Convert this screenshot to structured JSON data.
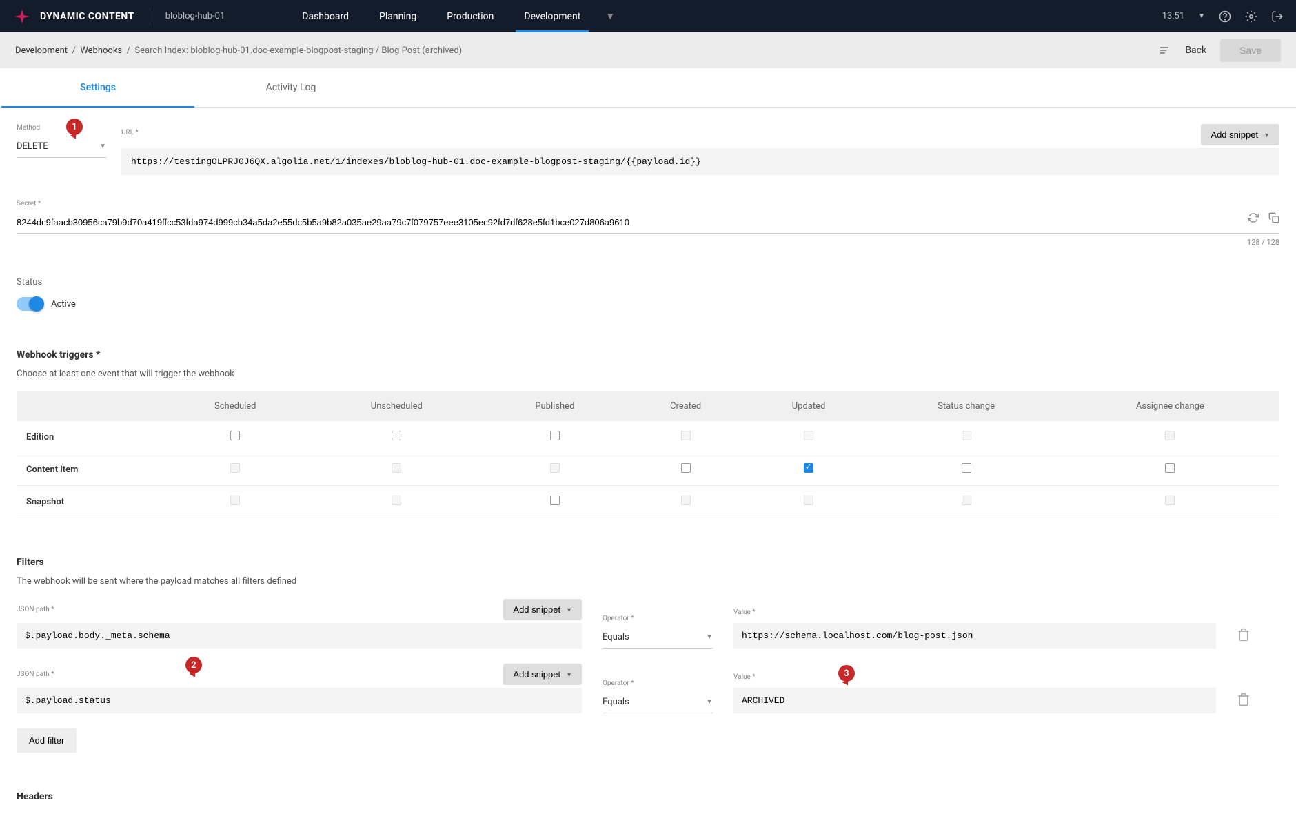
{
  "topbar": {
    "brand": "DYNAMIC CONTENT",
    "hub": "bloblog-hub-01",
    "nav": [
      "Dashboard",
      "Planning",
      "Production",
      "Development"
    ],
    "time": "13:51"
  },
  "subheader": {
    "crumb1": "Development",
    "crumb2": "Webhooks",
    "crumb3": "Search Index: bloblog-hub-01.doc-example-blogpost-staging / Blog Post (archived)",
    "back": "Back",
    "save": "Save"
  },
  "tabs": {
    "settings": "Settings",
    "activity": "Activity Log"
  },
  "method": {
    "label": "Method",
    "value": "DELETE"
  },
  "url": {
    "label": "URL *",
    "value": "https://testingOLPRJ0J6QX.algolia.net/1/indexes/bloblog-hub-01.doc-example-blogpost-staging/{{payload.id}}",
    "add_snippet": "Add snippet"
  },
  "secret": {
    "label": "Secret *",
    "value": "8244dc9faacb30956ca79b9d70a419ffcc53fda974d999cb34a5da2e55dc5b5a9b82a035ae29aa79c7f079757eee3105ec92fd7df628e5fd1bce027d806a9610",
    "count": "128 / 128"
  },
  "status": {
    "label": "Status",
    "active": "Active"
  },
  "triggers": {
    "title": "Webhook triggers *",
    "sub": "Choose at least one event that will trigger the webhook",
    "cols": [
      "Scheduled",
      "Unscheduled",
      "Published",
      "Created",
      "Updated",
      "Status change",
      "Assignee change"
    ],
    "rows": [
      "Edition",
      "Content item",
      "Snapshot"
    ]
  },
  "filters": {
    "title": "Filters",
    "sub": "The webhook will be sent where the payload matches all filters defined",
    "json_label": "JSON path *",
    "op_label": "Operator *",
    "val_label": "Value *",
    "add_snippet": "Add snippet",
    "op_value": "Equals",
    "rows": [
      {
        "json": "$.payload.body._meta.schema",
        "val": "https://schema.localhost.com/blog-post.json"
      },
      {
        "json": "$.payload.status",
        "val": "ARCHIVED"
      }
    ],
    "add_filter": "Add filter"
  },
  "headers": {
    "title": "Headers"
  },
  "badges": {
    "b1": "1",
    "b2": "2",
    "b3": "3"
  }
}
